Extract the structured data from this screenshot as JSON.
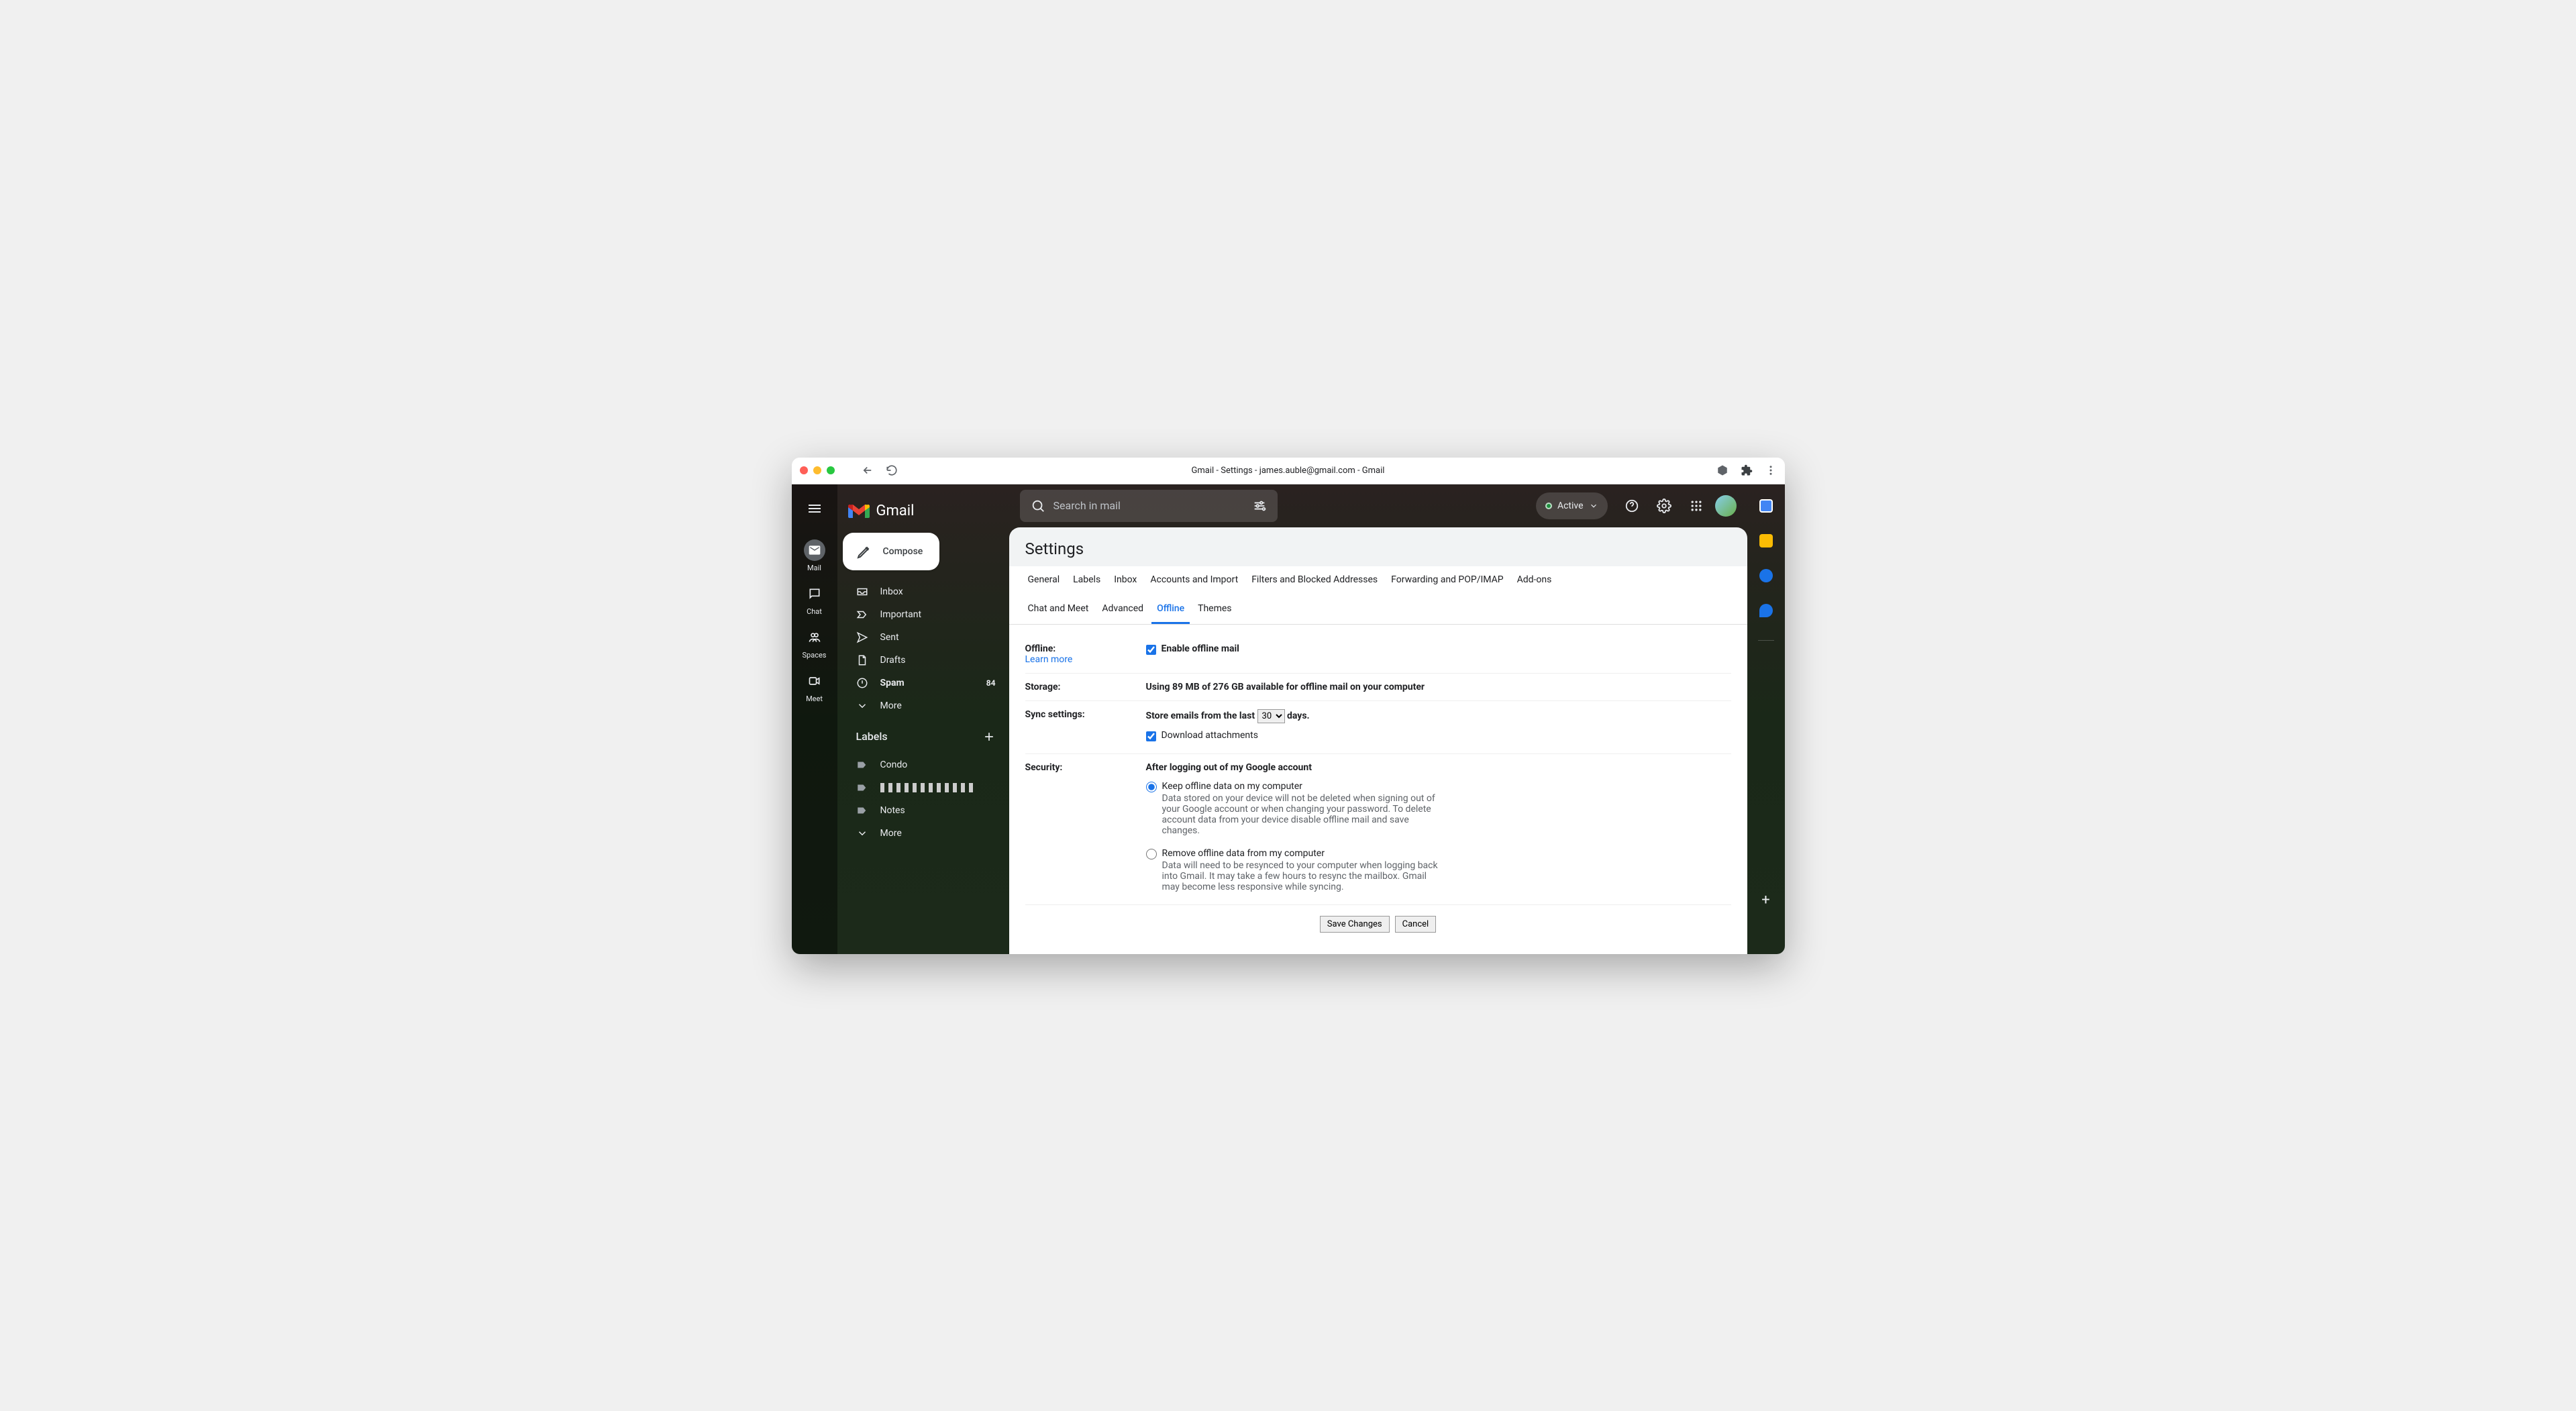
{
  "titlebar": {
    "page_title": "Gmail - Settings - james.auble@gmail.com - Gmail"
  },
  "brand": {
    "name": "Gmail"
  },
  "left_rail": {
    "items": [
      {
        "label": "Mail"
      },
      {
        "label": "Chat"
      },
      {
        "label": "Spaces"
      },
      {
        "label": "Meet"
      }
    ]
  },
  "compose": {
    "label": "Compose"
  },
  "sidebar": {
    "items": [
      {
        "label": "Inbox"
      },
      {
        "label": "Important"
      },
      {
        "label": "Sent"
      },
      {
        "label": "Drafts"
      },
      {
        "label": "Spam",
        "count": "84"
      },
      {
        "label": "More"
      }
    ],
    "labels_header": "Labels",
    "labels": [
      {
        "label": "Condo"
      },
      {
        "label": ""
      },
      {
        "label": "Notes"
      },
      {
        "label": "More"
      }
    ]
  },
  "search": {
    "placeholder": "Search in mail"
  },
  "status_chip": {
    "label": "Active"
  },
  "settings": {
    "title": "Settings",
    "tabs": [
      "General",
      "Labels",
      "Inbox",
      "Accounts and Import",
      "Filters and Blocked Addresses",
      "Forwarding and POP/IMAP",
      "Add-ons",
      "Chat and Meet",
      "Advanced",
      "Offline",
      "Themes"
    ],
    "offline": {
      "label": "Offline:",
      "learn_more": "Learn more",
      "enable_label": "Enable offline mail"
    },
    "storage": {
      "label": "Storage:",
      "value": "Using 89 MB of 276 GB available for offline mail on your computer"
    },
    "sync": {
      "label": "Sync settings:",
      "prefix": "Store emails from the last",
      "selected_days": "30",
      "suffix": "days.",
      "download_label": "Download attachments"
    },
    "security": {
      "label": "Security:",
      "heading": "After logging out of my Google account",
      "opt1_title": "Keep offline data on my computer",
      "opt1_desc": "Data stored on your device will not be deleted when signing out of your Google account or when changing your password. To delete account data from your device disable offline mail and save changes.",
      "opt2_title": "Remove offline data from my computer",
      "opt2_desc": "Data will need to be resynced to your computer when logging back into Gmail. It may take a few hours to resync the mailbox. Gmail may become less responsive while syncing."
    },
    "buttons": {
      "save": "Save Changes",
      "cancel": "Cancel"
    }
  }
}
